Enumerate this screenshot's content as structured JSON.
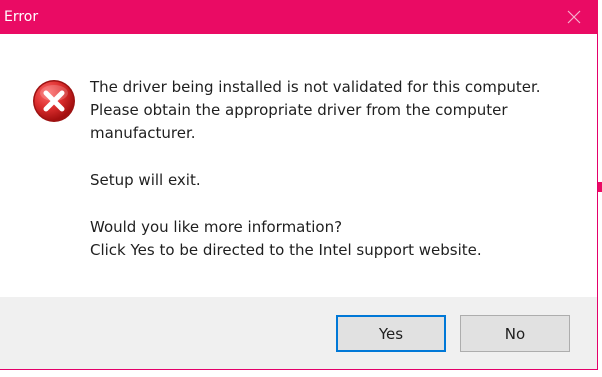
{
  "window": {
    "title": "Error",
    "close_icon": "close-icon",
    "accent_color": "#ea0b64"
  },
  "dialog": {
    "icon": "error-icon",
    "message_lines": [
      "The driver being installed is not validated for this computer.",
      "Please obtain the appropriate driver from the computer",
      "manufacturer."
    ],
    "exit_text": "Setup will exit.",
    "question": "Would you like more information?",
    "instruction": "Click Yes to be directed to the Intel support website."
  },
  "buttons": {
    "yes_label": "Yes",
    "no_label": "No",
    "default_button": "Yes"
  }
}
